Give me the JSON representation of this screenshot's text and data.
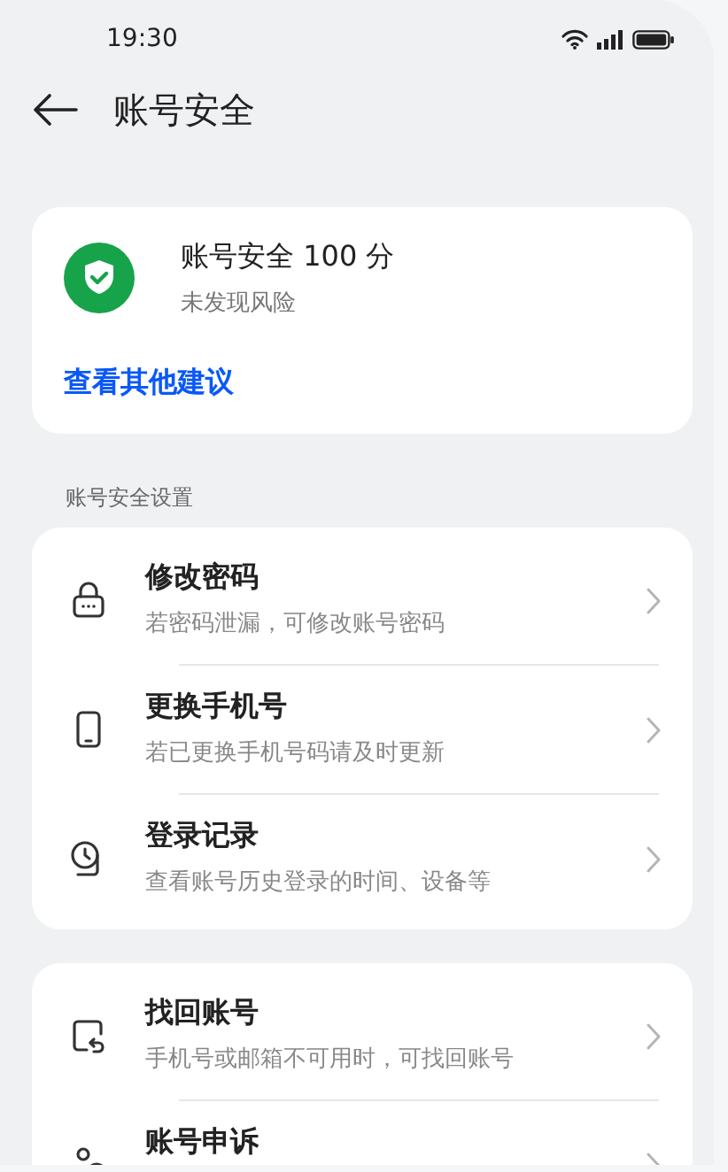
{
  "status_bar": {
    "time": "19:30"
  },
  "header": {
    "title": "账号安全"
  },
  "score_card": {
    "title": "账号安全 100 分",
    "subtitle": "未发现风险",
    "link": "查看其他建议"
  },
  "sections": [
    {
      "label": "账号安全设置",
      "items": [
        {
          "kind": "lock",
          "title": "修改密码",
          "subtitle": "若密码泄漏，可修改账号密码"
        },
        {
          "kind": "phone",
          "title": "更换手机号",
          "subtitle": "若已更换手机号码请及时更新"
        },
        {
          "kind": "history",
          "title": "登录记录",
          "subtitle": "查看账号历史登录的时间、设备等"
        }
      ]
    },
    {
      "items": [
        {
          "kind": "recover",
          "title": "找回账号",
          "subtitle": "手机号或邮箱不可用时，可找回账号"
        },
        {
          "kind": "appeal",
          "title": "账号申诉"
        }
      ]
    }
  ]
}
